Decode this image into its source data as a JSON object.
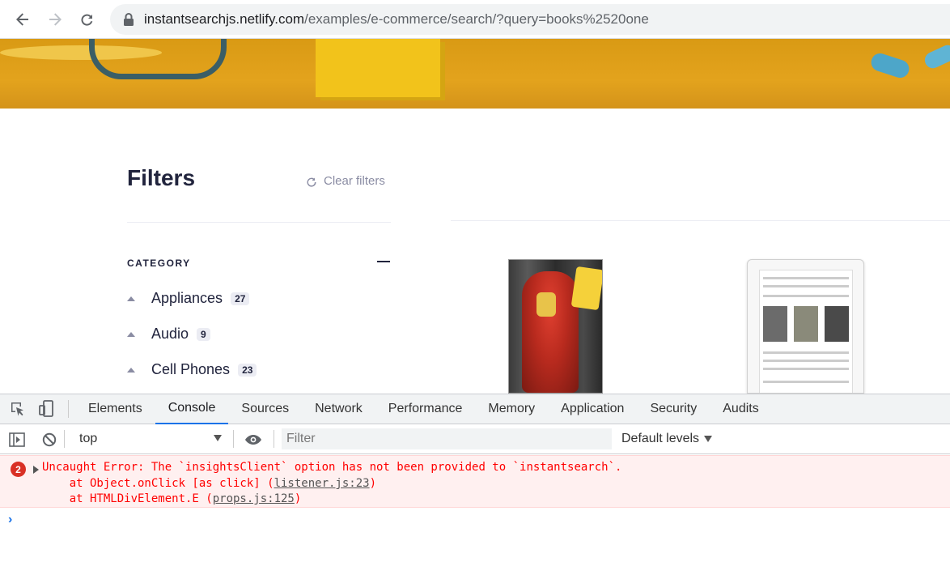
{
  "browser": {
    "url_host": "instantsearchjs.netlify.com",
    "url_path": "/examples/e-commerce/search/?query=books%2520one"
  },
  "filters": {
    "title": "Filters",
    "clear_label": "Clear filters",
    "category_heading": "CATEGORY",
    "categories": [
      {
        "label": "Appliances",
        "count": "27"
      },
      {
        "label": "Audio",
        "count": "9"
      },
      {
        "label": "Cell Phones",
        "count": "23"
      }
    ]
  },
  "devtools": {
    "tabs": [
      "Elements",
      "Console",
      "Sources",
      "Network",
      "Performance",
      "Memory",
      "Application",
      "Security",
      "Audits"
    ],
    "active_tab": "Console",
    "context": "top",
    "filter_placeholder": "Filter",
    "levels_label": "Default levels",
    "error": {
      "count": "2",
      "message": "Uncaught Error: The `insightsClient` option has not been provided to `instantsearch`.",
      "stack": [
        {
          "prefix": "    at Object.onClick [as click] (",
          "link": "listener.js:23",
          "suffix": ")"
        },
        {
          "prefix": "    at HTMLDivElement.E (",
          "link": "props.js:125",
          "suffix": ")"
        }
      ]
    },
    "prompt": "›"
  },
  "colors": {
    "accent": "#1a73e8",
    "error_text": "#ff0000",
    "error_bg": "#fff0f0",
    "banner": "#e3a31d"
  }
}
